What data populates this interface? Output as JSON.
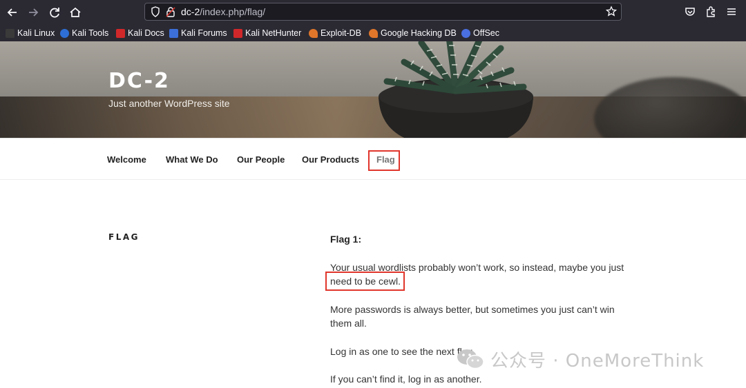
{
  "browser": {
    "url_host": "dc-2",
    "url_path": "/index.php/flag/",
    "icons": [
      "back-icon",
      "forward-icon",
      "reload-icon",
      "home-icon",
      "shield-icon",
      "insecure-lock-icon",
      "star-icon",
      "pocket-icon",
      "extensions-icon",
      "menu-icon"
    ]
  },
  "bookmarks": [
    {
      "label": "Kali Linux",
      "color": "#3a3a3a"
    },
    {
      "label": "Kali Tools",
      "color": "#2d6fd6"
    },
    {
      "label": "Kali Docs",
      "color": "#d0282a"
    },
    {
      "label": "Kali Forums",
      "color": "#3c6fd8"
    },
    {
      "label": "Kali NetHunter",
      "color": "#d0282a"
    },
    {
      "label": "Exploit-DB",
      "color": "#e0762a"
    },
    {
      "label": "Google Hacking DB",
      "color": "#e0762a"
    },
    {
      "label": "OffSec",
      "color": "#4a6fe0"
    }
  ],
  "site": {
    "title": "DC-2",
    "tagline": "Just another WordPress site"
  },
  "nav": {
    "items": [
      "Welcome",
      "What We Do",
      "Our People",
      "Our Products",
      "Flag"
    ]
  },
  "page": {
    "heading": "FLAG",
    "flag_label": "Flag 1:",
    "p1_a": "Your usual wordlists probably won’t work, so instead, maybe you just",
    "p1_b": "need to be cewl.",
    "p2": "More passwords is always better, but sometimes you just can’t win them all.",
    "p3": "Log in as one to see the next flag.",
    "p4": "If you can’t find it, log in as another."
  },
  "watermark": {
    "text": "公众号 · OneMoreThink"
  },
  "colors": {
    "highlight_box": "#e0352b",
    "chrome_bg": "#2b2a33"
  }
}
